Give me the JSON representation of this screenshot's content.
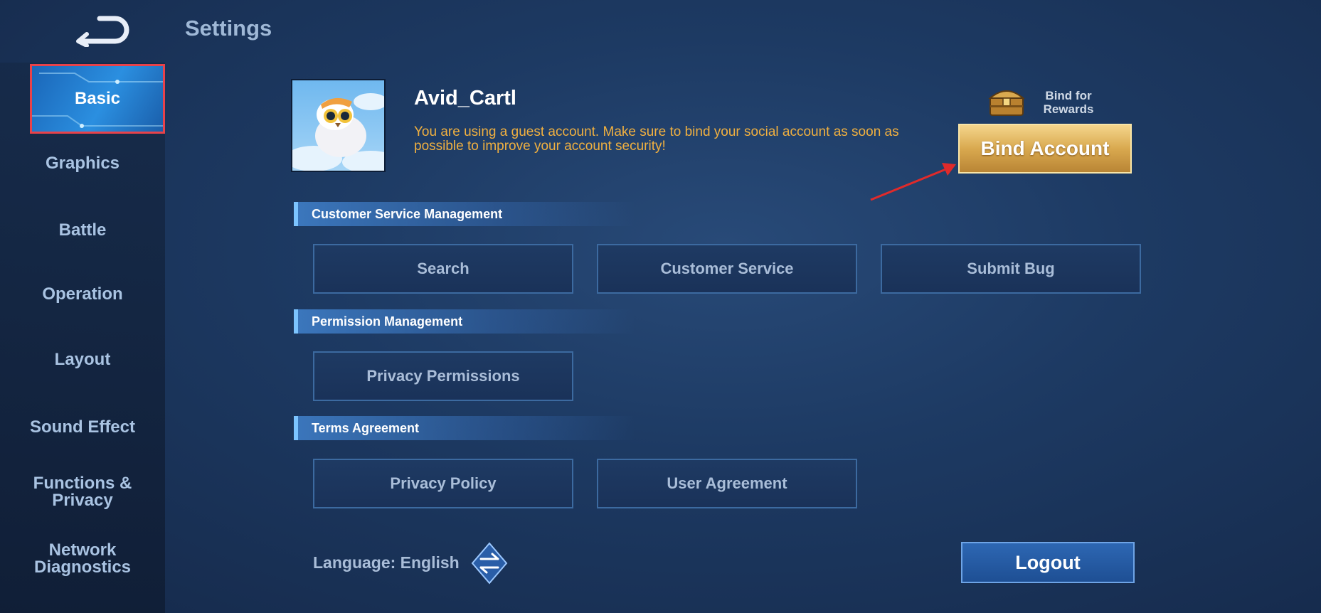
{
  "header": {
    "title": "Settings",
    "back_icon": "back-arrow-icon"
  },
  "sidebar": {
    "items": [
      {
        "label": "Basic",
        "active": true
      },
      {
        "label": "Graphics"
      },
      {
        "label": "Battle"
      },
      {
        "label": "Operation"
      },
      {
        "label": "Layout"
      },
      {
        "label": "Sound Effect"
      },
      {
        "label": "Functions &\nPrivacy"
      },
      {
        "label": "Network\nDiagnostics"
      }
    ]
  },
  "profile": {
    "username": "Avid_Cartl",
    "warning": "You are using a guest account. Make sure to bind your social account as soon as possible to improve your account security!"
  },
  "rewards": {
    "label": "Bind for\nRewards",
    "icon": "treasure-chest-icon"
  },
  "bind_button": {
    "label": "Bind Account"
  },
  "sections": {
    "customer_service": {
      "title": "Customer Service Management",
      "buttons": [
        "Search",
        "Customer Service",
        "Submit Bug"
      ]
    },
    "permission": {
      "title": "Permission Management",
      "buttons": [
        "Privacy Permissions"
      ]
    },
    "terms": {
      "title": "Terms Agreement",
      "buttons": [
        "Privacy Policy",
        "User Agreement"
      ]
    }
  },
  "language": {
    "label": "Language: English",
    "icon": "swap-arrows-icon"
  },
  "logout": {
    "label": "Logout"
  },
  "colors": {
    "highlight_border": "#e8424a",
    "warning_text": "#f0b040",
    "gold_button": "#d9a94f",
    "active_tab": "#2b8fe0"
  }
}
